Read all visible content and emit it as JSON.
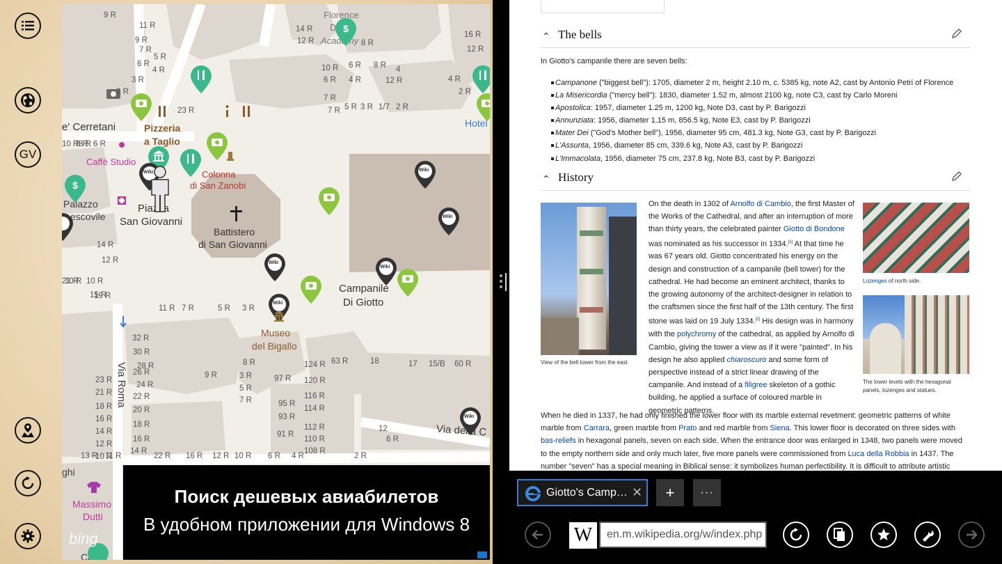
{
  "map_app": {
    "rail": {
      "menu_icon": "list-icon",
      "globe_icon": "globe-icon",
      "gv_label": "GV",
      "location_icon": "person-pin-icon",
      "refresh_icon": "refresh-icon",
      "settings_icon": "gear-icon"
    },
    "labels": {
      "florence": "Florence",
      "academy_a": "D",
      "academy_b": "Academy",
      "cerretani": "e' Cerretani",
      "pizzeria_1": "Pizzeria",
      "pizzeria_2": "a Taglio",
      "caffe": "Caffè Studio",
      "colonna_1": "Colonna",
      "colonna_2": "di San Zanobi",
      "palazzo_1": "Palazzo",
      "palazzo_2": "escovile",
      "piazza_1": "Piazza",
      "piazza_2": "San Giovanni",
      "battistero_1": "Battistero",
      "battistero_2": "di San Giovanni",
      "campanile_1": "Campanile",
      "campanile_2": "Di Giotto",
      "museo_1": "Museo",
      "museo_2": "del Bigallo",
      "via_roma": "Via Roma",
      "via_della": "Via della C",
      "hotel": "Hotel",
      "massimo_1": "Massimo",
      "massimo_2": "Dutti",
      "ghi": "ghi",
      "caffe2": "Caffè"
    },
    "numbers": {
      "n1": "11 R",
      "n2": "9 R",
      "n3": "7 R",
      "n4": "5 R",
      "n5": "6 R",
      "n6": "4 R",
      "n7": "3 R",
      "n8": "2 R",
      "n9": "23 R",
      "n10": "7 R",
      "n11": "5 R",
      "n12": "3 R",
      "n13": "1/7",
      "n14": "2 R",
      "n15": "14 R",
      "n16": "12 R",
      "n17": "10 R",
      "n18": "8 R",
      "n19": "6 R",
      "n20": "4 R",
      "n21": "2 R",
      "n22": "16 R",
      "n23": "12 R",
      "n24": "10 R",
      "n25": "8 R",
      "n26": "6 R",
      "n27": "14 R",
      "n28": "12 R",
      "n29": "10 R",
      "n30": "32 R",
      "n31": "30 R",
      "n32": "28 R",
      "n33": "26 R",
      "n34": "24 R",
      "n35": "23 R",
      "n36": "22 R",
      "n37": "21 R",
      "n38": "20 R",
      "n39": "18 R",
      "n40": "16 R",
      "n41": "14 R",
      "n42": "18 R",
      "n43": "16 R",
      "n44": "14 R",
      "n45": "12 R",
      "n46": "10 R",
      "n47": "8 R",
      "n48": "9 R",
      "n49": "3 R",
      "n50": "5 R",
      "n51": "7 R",
      "n52": "97 R",
      "n53": "124 R",
      "n54": "63 R",
      "n55": "18",
      "n56": "17",
      "n57": "15/B",
      "n58": "60 R",
      "n59": "120 R",
      "n60": "116 R",
      "n61": "114 R",
      "n62": "112 R",
      "n63": "110 R",
      "n64": "108 R",
      "n65": "95 R",
      "n66": "93 R",
      "n67": "91 R",
      "n68": "12",
      "n69": "6 R",
      "n70": "22 R",
      "n71": "16 R",
      "n72": "12 R",
      "n73": "10 R",
      "n74": "6 R",
      "n75": "4 R",
      "n76": "2 R",
      "n77": "13 R",
      "n78": "11 R",
      "n79": "15 R",
      "n80": "11 R",
      "n81": "7 R",
      "n82": "5 R",
      "n83": "3 R",
      "n84": "21 R",
      "n85": "19 R",
      "n86": "8 R",
      "n87": "9 R",
      "n88": "7 R",
      "n89": "4",
      "n90": "12 R",
      "n91": "8 R",
      "n92": "6 R",
      "n93": "4 R",
      "n94": "10 R"
    },
    "wiki_pin": "Wiki",
    "ad": {
      "title": "Поиск дешевых авиабилетов",
      "subtitle": "В удобном приложении для Windows 8",
      "bing": "bing"
    }
  },
  "article": {
    "bells": {
      "heading": "The bells",
      "intro": "In Giotto's campanile there are seven bells:",
      "items": [
        {
          "name": "Campanone",
          "rest": " (\"biggest bell\"): 1705, diameter 2 m, height 2.10 m, c. 5385 kg, note A2, cast by Antonio Petri of Florence"
        },
        {
          "name": "La Misericordia",
          "rest": " (\"mercy bell\"): 1830, diameter 1.52 m, almost 2100 kg, note C3, cast by Carlo Moreni"
        },
        {
          "name": "Apostolica",
          "rest": ": 1957, diameter 1.25 m, 1200 kg, Note D3, cast by P. Barigozzi"
        },
        {
          "name": "Annunziata",
          "rest": ": 1956, diameter 1.15 m, 856.5 kg, Note E3, cast by P. Barigozzi"
        },
        {
          "name": "Mater Dei",
          "rest": " (\"God's Mother bell\"), 1956, diameter 95 cm, 481.3 kg, Note G3, cast by P. Barigozzi"
        },
        {
          "name": "L'Assunta",
          "rest": ", 1956, diameter 85 cm, 339.6 kg, Note A3, cast by P. Barigozzi"
        },
        {
          "name": "L'Immacolata",
          "rest": ", 1956, diameter 75 cm, 237.8 kg, Note B3, cast by P. Barigozzi"
        }
      ]
    },
    "history": {
      "heading": "History",
      "caption_tower": "View of the bell tower from the east",
      "caption_lozenges_link": "Lozenges",
      "caption_lozenges_rest": " of north side.",
      "caption_lower": "The lower levels with the hexagonal panels, lozenges and statues.",
      "p1": {
        "a": "On the death in 1302 of ",
        "l1": "Arnolfo di Cambio",
        "b": ", the first Master of the Works of the Cathedral, and after an interruption of more than thirty years, the celebrated painter ",
        "l2": "Giotto di Bondone",
        "c": " was nominated as his successor in 1334.",
        "r1": "[1]",
        "d": " At that time he was 67 years old. Giotto concentrated his energy on the design and construction of a campanile (bell tower) for the cathedral. He had become an eminent architect, thanks to the growing autonomy of the architect-designer in relation to the craftsmen since the first half of the 13th century. The first stone was laid on 19 July 1334.",
        "r2": "[2]",
        "e": " His design was in harmony with the ",
        "l3": "polychromy",
        "f": " of the cathedral, as applied by Arnolfo di Cambio, giving the tower a view as if it were \"painted\". In his design he also applied ",
        "l4": "chiaroscuro",
        "g": " and some form of perspective instead of a strict linear drawing of the campanile. And instead of a ",
        "l5": "filigree",
        "h": " skeleton of a gothic building, he applied a surface of coloured marble in geometric patterns."
      },
      "p2": {
        "a": "When he died in 1337, he had only finished the lower floor with its marble external revetment: geometric patterns of white marble from ",
        "l1": "Carrara",
        "b": ", green marble from ",
        "l2": "Prato",
        "c": " and red marble from ",
        "l3": "Siena",
        "d": ". This lower floor is decorated on three sides with ",
        "l4": "bas-reliefs",
        "e": " in hexagonal panels, seven on each side. When the entrance door was enlarged in 1348, two panels were moved to the empty northern side and only much later, five more panels were commissioned from ",
        "l5": "Luca della Robbia",
        "f": " in 1437. The number \"seven\" has a special meaning in Biblical sense: it symbolizes human perfectibility. It is difficult to attribute artistic"
      }
    }
  },
  "browser": {
    "tab_title": "Giotto's Camp…",
    "tab_close": "✕",
    "new_tab": "+",
    "more": "···",
    "site_letter": "W",
    "url": "en.m.wikipedia.org/w/index.php",
    "colors": {
      "accent": "#3a7bd5",
      "link": "#0645ad"
    }
  }
}
